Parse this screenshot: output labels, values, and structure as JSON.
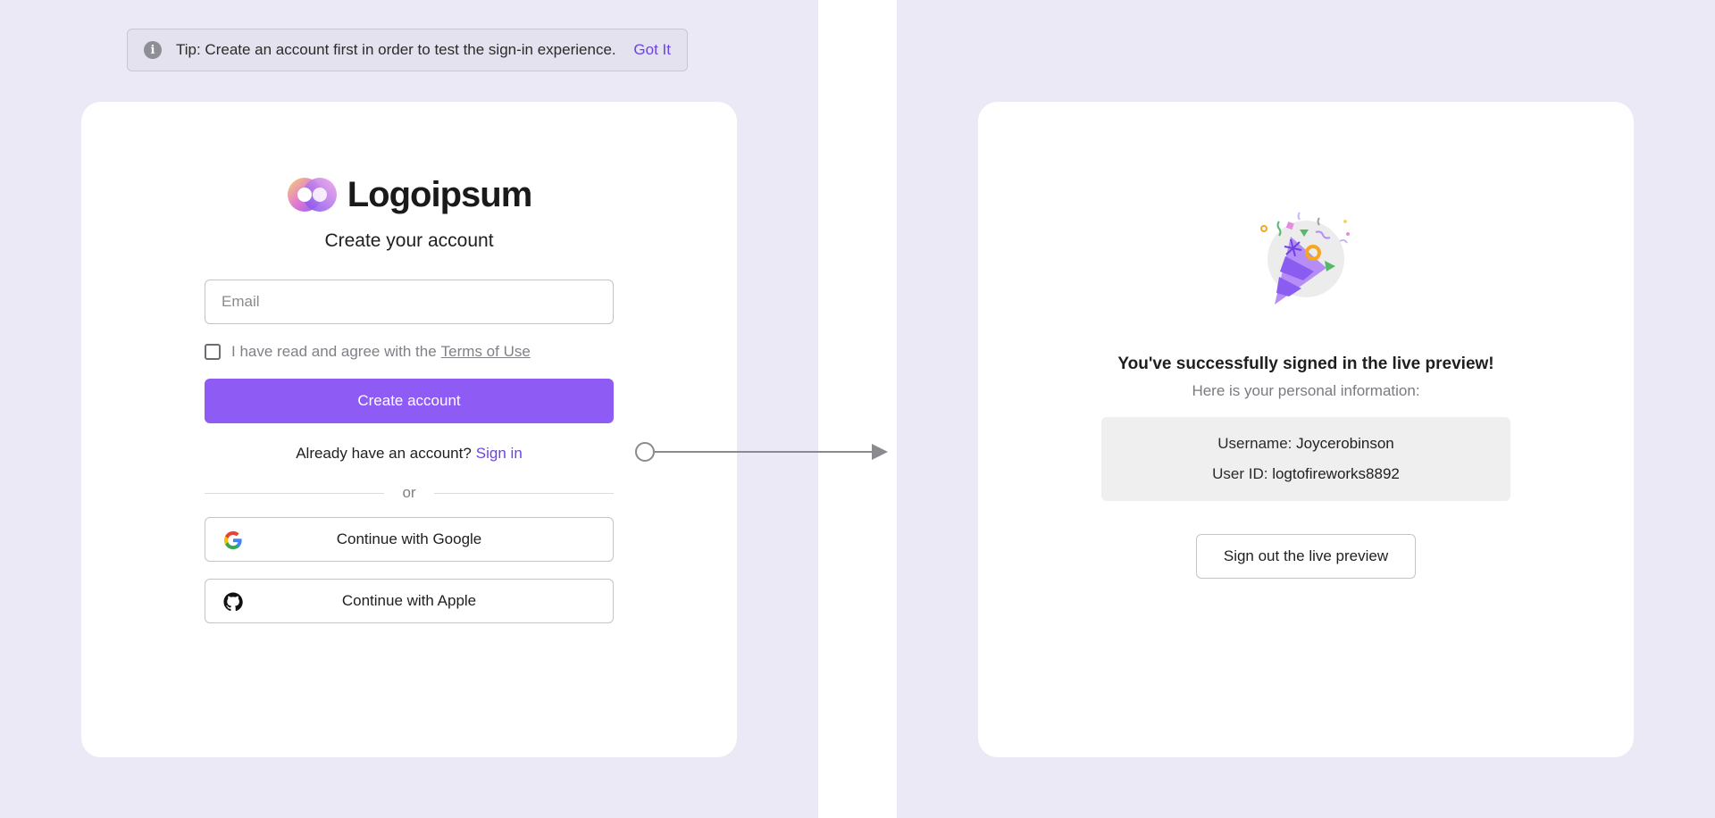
{
  "tip": {
    "text": "Tip: Create an account first in order to test the sign-in experience.",
    "action": "Got It"
  },
  "signup": {
    "logo_text": "Logoipsum",
    "title": "Create your account",
    "email_placeholder": "Email",
    "terms_text": "I have read and agree with the",
    "terms_link": "Terms of Use",
    "create_button": "Create account",
    "already_text": "Already have an account?",
    "signin_link": "Sign in",
    "divider_text": "or",
    "google_button": "Continue with Google",
    "apple_button": "Continue with Apple"
  },
  "success": {
    "title": "You've successfully signed in the live preview!",
    "subtitle": "Here is your personal information:",
    "username_label": "Username:",
    "username_value": "Joycerobinson",
    "userid_label": "User ID:",
    "userid_value": "logtofireworks8892",
    "signout_button": "Sign out the live preview"
  },
  "colors": {
    "background": "#ebe9f5",
    "primary": "#8e5cf4",
    "link": "#6b44e0"
  }
}
